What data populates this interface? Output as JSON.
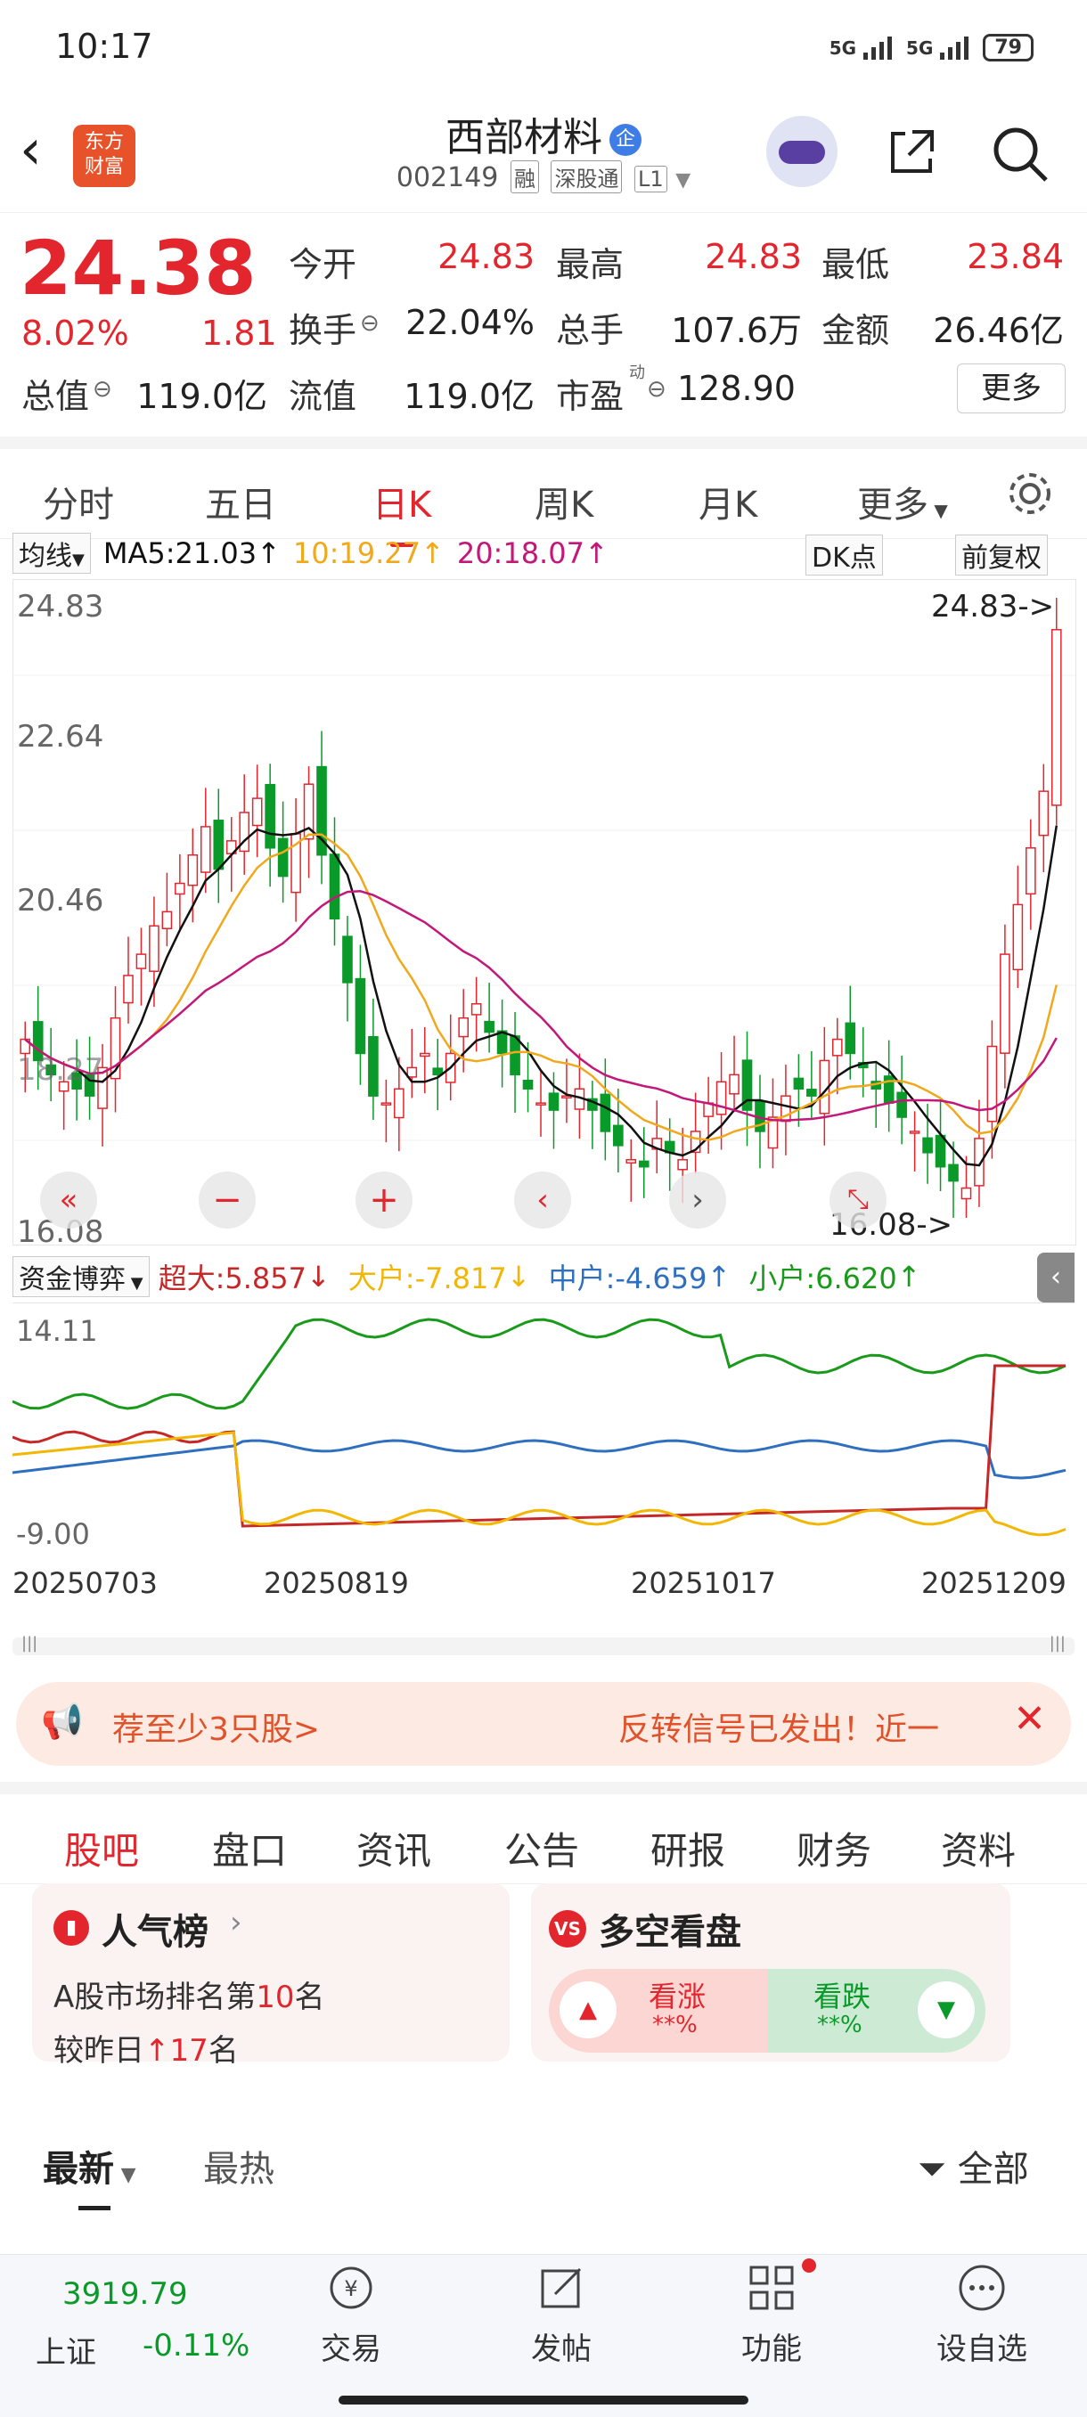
{
  "status_bar": {
    "time": "10:17",
    "signal1": "5G",
    "signal2": "5G",
    "battery": "79"
  },
  "header": {
    "logo_text": "东方\n财富",
    "stock_name": "西部材料",
    "badge": "企",
    "code": "002149",
    "tags": [
      "融",
      "深股通",
      "L1"
    ]
  },
  "quote": {
    "price": "24.38",
    "change_pct": "8.02%",
    "change": "1.81",
    "open_label": "今开",
    "open": "24.83",
    "high_label": "最高",
    "high": "24.83",
    "low_label": "最低",
    "low": "23.84",
    "turnover_label": "换手",
    "turnover": "22.04%",
    "volume_label": "总手",
    "volume": "107.6万",
    "amount_label": "金额",
    "amount": "26.46亿",
    "mktcap_label": "总值",
    "mktcap": "119.0亿",
    "float_label": "流值",
    "float": "119.0亿",
    "pe_label": "市盈",
    "pe_sup": "动",
    "pe": "128.90",
    "more_label": "更多"
  },
  "kline_tabs": [
    "分时",
    "五日",
    "日K",
    "周K",
    "月K",
    "更多"
  ],
  "kline_active": "日K",
  "ma": {
    "selector": "均线",
    "ma5": "MA5:21.03",
    "ma10": "10:19.27",
    "ma20": "20:18.07",
    "dk_label": "DK点",
    "adjust": "前复权",
    "colors": {
      "ma5": "#111111",
      "ma10": "#f0a81c",
      "ma20": "#c2187a"
    }
  },
  "chart_axis": {
    "y_top": "24.83",
    "y_2": "22.64",
    "y_3": "20.46",
    "y_low": "16.08",
    "max_marker": "24.83->",
    "min_marker": "16.08->",
    "label_18": "18.27"
  },
  "chart_data": {
    "type": "candlestick",
    "ylim": [
      16.08,
      24.83
    ],
    "note_ticks": [
      "24.83",
      "22.64",
      "20.46",
      "18.27",
      "16.08"
    ],
    "closes": [
      18.6,
      18.3,
      18.1,
      18.0,
      17.9,
      17.8,
      18.2,
      18.9,
      19.5,
      19.8,
      20.2,
      20.4,
      20.8,
      21.2,
      21.6,
      21.0,
      21.4,
      21.8,
      22.0,
      21.3,
      20.9,
      21.5,
      22.2,
      21.2,
      20.3,
      19.4,
      18.4,
      17.8,
      17.7,
      17.9,
      18.2,
      18.4,
      18.1,
      18.4,
      18.9,
      19.1,
      18.7,
      18.4,
      18.1,
      17.9,
      17.7,
      17.6,
      17.8,
      17.9,
      17.6,
      17.3,
      17.1,
      16.9,
      16.8,
      17.2,
      17.0,
      16.9,
      17.3,
      17.7,
      18.0,
      18.1,
      17.6,
      17.3,
      17.5,
      17.8,
      17.9,
      17.8,
      18.3,
      18.6,
      18.4,
      18.2,
      17.9,
      17.7,
      17.5,
      17.3,
      17.0,
      16.8,
      16.6,
      16.5,
      17.2,
      18.5,
      19.8,
      20.5,
      21.3,
      22.1,
      24.38
    ],
    "ma_labels": [
      "MA5",
      "MA10",
      "MA20"
    ]
  },
  "flow": {
    "selector": "资金博弈",
    "super": "超大:5.857",
    "big": "大户:-7.817",
    "mid": "中户:-4.659",
    "small": "小户:6.620",
    "y_top": "14.11",
    "y_bottom": "-9.00",
    "colors": {
      "super": "#c62828",
      "big": "#f2b705",
      "mid": "#2f6fbf",
      "small": "#1a9a1a"
    }
  },
  "dates": [
    "20250703",
    "20250819",
    "20251017",
    "20251209"
  ],
  "banner": {
    "left": "荐至少3只股>",
    "right": "反转信号已发出！近一"
  },
  "section_tabs": [
    "股吧",
    "盘口",
    "资讯",
    "公告",
    "研报",
    "财务",
    "资料"
  ],
  "popular": {
    "title": "人气榜",
    "rank_prefix": "A股市场排名第",
    "rank": "10",
    "rank_suffix": "名",
    "change_prefix": "较昨日",
    "change": "17",
    "change_suffix": "名"
  },
  "bull_bear": {
    "title": "多空看盘",
    "up_label": "看涨",
    "up_value": "**%",
    "down_label": "看跌",
    "down_value": "**%"
  },
  "feed_tabs": {
    "latest": "最新",
    "hot": "最热",
    "filter": "全部"
  },
  "bottom_nav": {
    "index_value": "3919.79",
    "index_name": "上证",
    "index_change": "-0.11%",
    "items": [
      "交易",
      "发帖",
      "功能",
      "设自选"
    ]
  }
}
